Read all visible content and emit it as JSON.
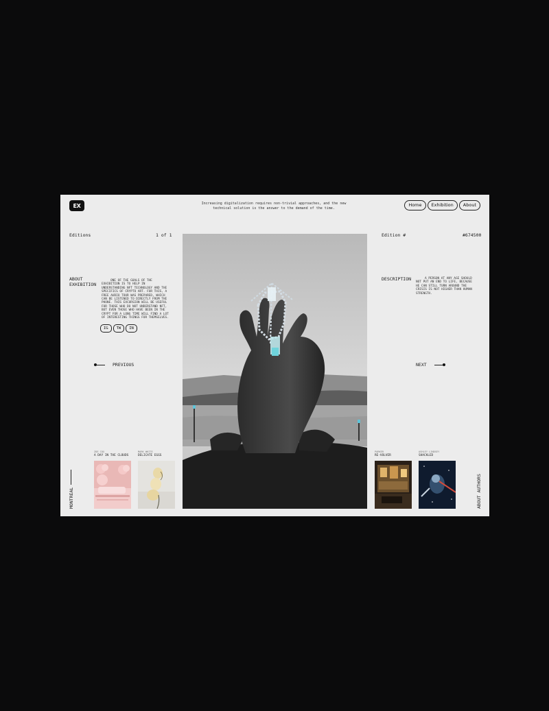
{
  "header": {
    "logo": "EX",
    "tagline": "Increasing digitalization requires non-trivial approaches, and the new technical solution is the answer to the demand of the time.",
    "nav": [
      "Home",
      "Exhibition",
      "About"
    ]
  },
  "left": {
    "editions_label": "Editions",
    "page_count": "1 of 1",
    "about_label_1": "ABOUT",
    "about_label_2": "EXHIBITION",
    "about_text": "One of the goals of the exhibition is to help in understanding NFT technology and the specifics of crypto art. For this, a free audio tour was prepared, which can be listened to directly from the phone. This excursion will be useful for those who do not understand NFT, but even those who have been in the crypt for a long time will find a lot of interesting things for themselves.",
    "social": [
      "IG",
      "TW",
      "IN"
    ],
    "previous_label": "PREVIOUS",
    "city": "MONTREAL",
    "thumbs": [
      {
        "author": "Zoe Cox",
        "title": "A DAY IN THE CLOUDS"
      },
      {
        "author": "Mark White",
        "title": "DELICATE EGGS"
      }
    ]
  },
  "right": {
    "edition_label": "Edition #",
    "edition_number": "#674500",
    "description_label": "DESCRIPTION",
    "description_text": "A person at any age should not put an end to life, because he can still turn around the crisis is not higher than human strength.",
    "next_label": "NEXT",
    "about_authors": "ABOUT AUTHORS",
    "thumbs": [
      {
        "author": "Parker",
        "title": "RE-VOLVER"
      },
      {
        "author": "Ashley Lindsey",
        "title": "SHACKLED"
      }
    ]
  }
}
